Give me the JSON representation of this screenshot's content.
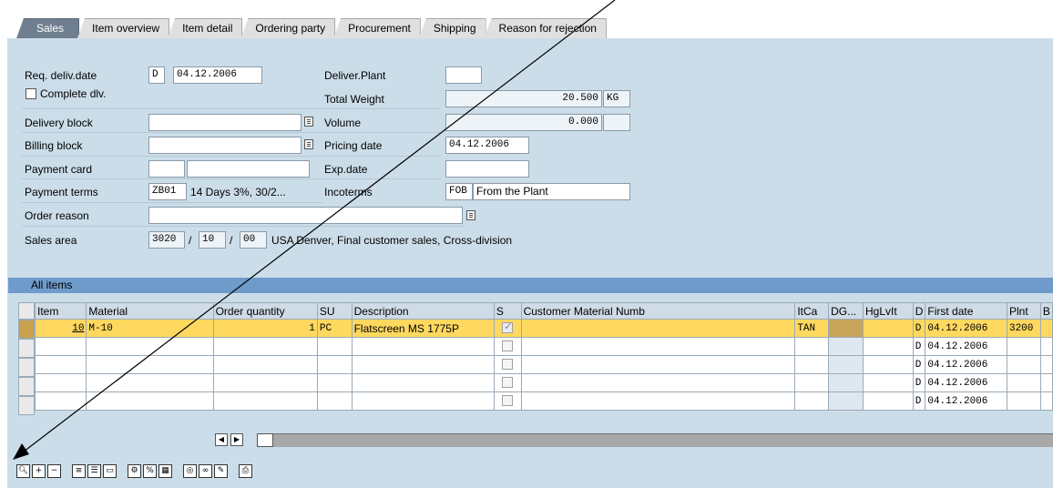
{
  "tabs": [
    "Sales",
    "Item overview",
    "Item detail",
    "Ordering party",
    "Procurement",
    "Shipping",
    "Reason for rejection"
  ],
  "header": {
    "req_deliv_label": "Req. deliv.date",
    "req_deliv_type": "D",
    "req_deliv_date": "04.12.2006",
    "complete_dlv_label": "Complete dlv.",
    "delivery_block_label": "Delivery block",
    "billing_block_label": "Billing block",
    "payment_card_label": "Payment card",
    "payment_terms_label": "Payment terms",
    "payment_terms_code": "ZB01",
    "payment_terms_text": "14 Days 3%, 30/2...",
    "order_reason_label": "Order reason",
    "sales_area_label": "Sales area",
    "sales_org": "3020",
    "dist_channel": "10",
    "division": "00",
    "sep": "/",
    "sales_area_text": "USA Denver, Final customer sales, Cross-division",
    "deliver_plant_label": "Deliver.Plant",
    "total_weight_label": "Total Weight",
    "total_weight_value": "20.500",
    "weight_unit": "KG",
    "volume_label": "Volume",
    "volume_value": "0.000",
    "pricing_date_label": "Pricing date",
    "pricing_date": "04.12.2006",
    "exp_date_label": "Exp.date",
    "incoterms_label": "Incoterms",
    "incoterms_code": "FOB",
    "incoterms_text": "From the Plant"
  },
  "grid": {
    "title": "All items",
    "columns": [
      "Item",
      "Material",
      "Order quantity",
      "SU",
      "Description",
      "S",
      "Customer Material Numb",
      "ItCa",
      "DG...",
      "HgLvIt",
      "D",
      "First date",
      "Plnt",
      "B"
    ],
    "rows": [
      {
        "item": "10",
        "material": "M-10",
        "qty": "1",
        "su": "PC",
        "description": "Flatscreen MS 1775P",
        "checked": true,
        "itca": "TAN",
        "d": "D",
        "first_date": "04.12.2006",
        "plant": "3200"
      },
      {
        "item": "",
        "material": "",
        "qty": "",
        "su": "",
        "description": "",
        "checked": false,
        "itca": "",
        "d": "D",
        "first_date": "04.12.2006",
        "plant": ""
      },
      {
        "item": "",
        "material": "",
        "qty": "",
        "su": "",
        "description": "",
        "checked": false,
        "itca": "",
        "d": "D",
        "first_date": "04.12.2006",
        "plant": ""
      },
      {
        "item": "",
        "material": "",
        "qty": "",
        "su": "",
        "description": "",
        "checked": false,
        "itca": "",
        "d": "D",
        "first_date": "04.12.2006",
        "plant": ""
      },
      {
        "item": "",
        "material": "",
        "qty": "",
        "su": "",
        "description": "",
        "checked": false,
        "itca": "",
        "d": "D",
        "first_date": "04.12.2006",
        "plant": ""
      }
    ]
  },
  "scroll_left_glyph": "◀",
  "scroll_right_glyph": "▶",
  "toolbar_icons": [
    "details-icon",
    "insert-row-icon",
    "delete-row-icon",
    "select-all-icon",
    "select-block-icon",
    "deselect-all-icon",
    "configuration-icon",
    "item-conditions-icon",
    "schedule-lines-icon",
    "availability-icon",
    "batch-determination-icon",
    "change-icon",
    "print-icon"
  ]
}
